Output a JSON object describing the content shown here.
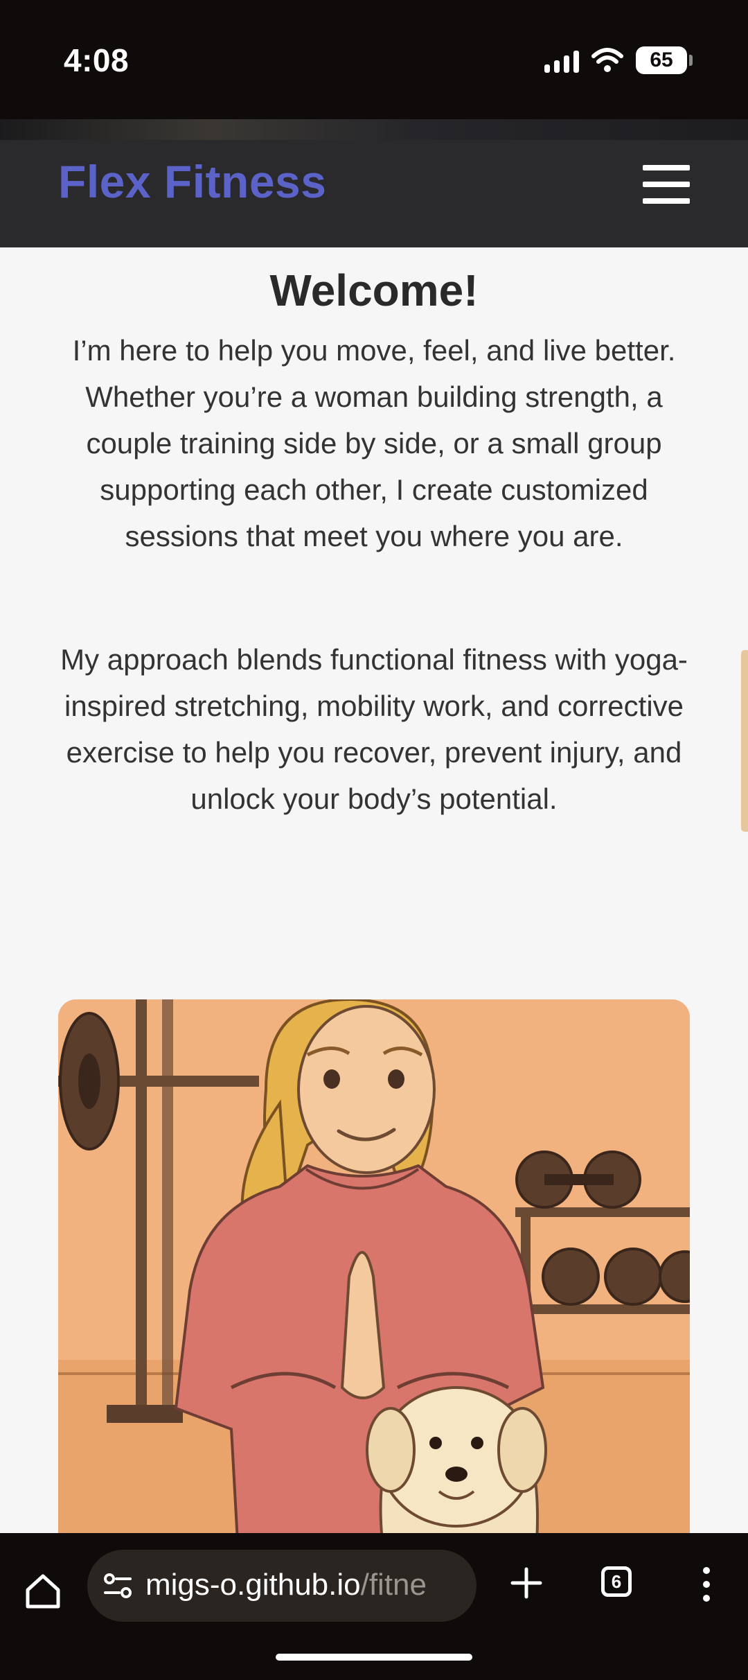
{
  "status_bar": {
    "time": "4:08",
    "battery": "65"
  },
  "header": {
    "logo": "Flex Fitness",
    "menu_icon": "hamburger-menu-icon"
  },
  "main": {
    "title": "Welcome!",
    "intro": "I’m here to help you move, feel, and live better. Whether you’re a woman building strength, a couple training side by side, or a small group supporting each other, I create customized sessions that meet you where you are.",
    "approach": "My approach blends functional fitness with yoga-inspired stretching, mobility work, and corrective exercise to help you recover, prevent injury, and unlock your body’s potential."
  },
  "browser": {
    "url_host": "migs-o.github.io",
    "url_path": "/fitne",
    "tab_count": "6"
  },
  "colors": {
    "brand": "#5b63c9",
    "header_bg": "#2a2a2c",
    "page_bg": "#f6f6f7"
  }
}
